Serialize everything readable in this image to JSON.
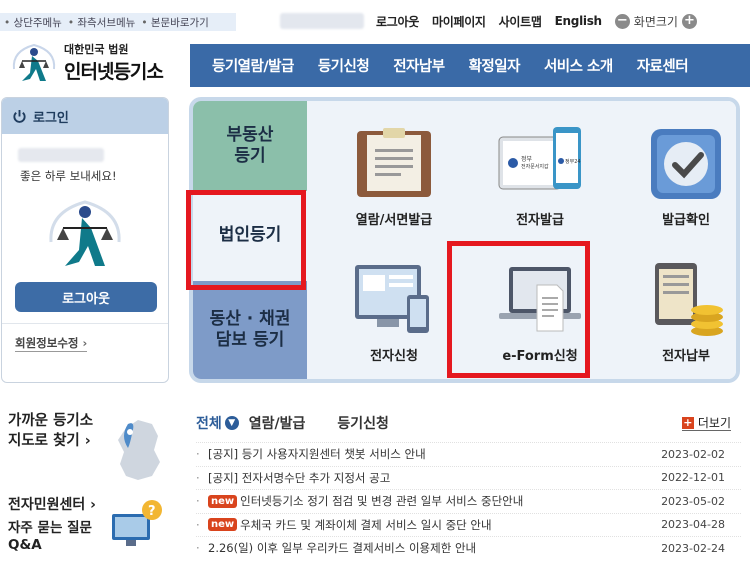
{
  "skip_links": [
    "상단주메뉴",
    "좌측서브메뉴",
    "본문바로가기"
  ],
  "util": {
    "logout": "로그아웃",
    "mypage": "마이페이지",
    "sitemap": "사이트맵",
    "english": "English",
    "size_minus": "−",
    "size_label": "화면크기",
    "size_plus": "+"
  },
  "logo": {
    "line1": "대한민국 법원",
    "line2": "인터넷등기소"
  },
  "gnb": [
    "등기열람/발급",
    "등기신청",
    "전자납부",
    "확정일자",
    "서비스 소개",
    "자료센터"
  ],
  "login": {
    "title": "로그인",
    "greeting": "좋은 하루 보내세요!",
    "logout_button": "로그아웃",
    "edit_member": "회원정보수정"
  },
  "service": {
    "tabs": [
      "부동산\n등기",
      "법인등기",
      "동산 · 채권\n담보 등기"
    ],
    "items": [
      "열람/서면발급",
      "전자발급",
      "발급확인",
      "전자신청",
      "e-Form신청",
      "전자납부"
    ],
    "tablet_text": "정부\n전자문서지갑",
    "phone_text": "정부24"
  },
  "side": {
    "near": [
      "가까운 등기소",
      "지도로 찾기"
    ],
    "civil": "전자민원센터",
    "faq": [
      "자주 묻는 질문",
      "Q&A"
    ]
  },
  "notice": {
    "tabs": [
      "전체",
      "열람/발급",
      "등기신청"
    ],
    "more": "더보기",
    "rows": [
      {
        "badge": "",
        "title": "[공지] 등기 사용자지원센터 챗봇 서비스 안내",
        "date": "2023-02-02"
      },
      {
        "badge": "",
        "title": "[공지] 전자서명수단 추가 지정서 공고",
        "date": "2022-12-01"
      },
      {
        "badge": "new",
        "title": "인터넷등기소 정기 점검 및 변경 관련 일부 서비스 중단안내",
        "date": "2023-05-02"
      },
      {
        "badge": "new",
        "title": "우체국 카드 및 계좌이체 결제 서비스 일시 중단 안내",
        "date": "2023-04-28"
      },
      {
        "badge": "",
        "title": "2.26(일) 이후 일부 우리카드 결제서비스 이용제한 안내",
        "date": "2023-02-24"
      }
    ]
  },
  "colors": {
    "gnb": "#3a6aa7",
    "highlight": "#e5181f",
    "tab_realestate": "#8bbfaa",
    "tab_movable": "#7e9bc8"
  }
}
